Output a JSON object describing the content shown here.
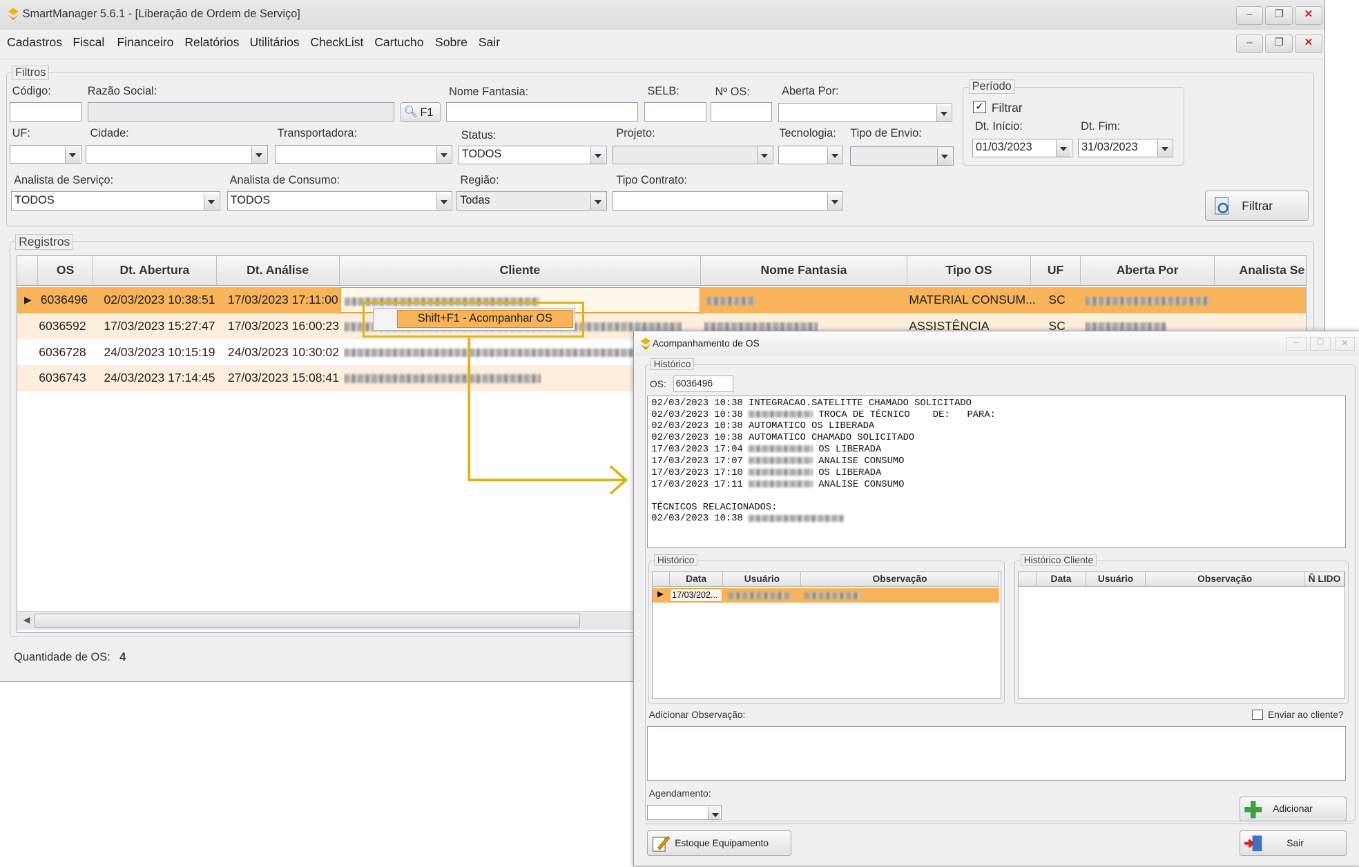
{
  "main": {
    "title": "SmartManager 5.6.1 - [Liberação de Ordem de Serviço]",
    "menu": [
      "Cadastros",
      "Fiscal",
      "Financeiro",
      "Relatórios",
      "Utilitários",
      "CheckList",
      "Cartucho",
      "Sobre",
      "Sair"
    ],
    "filters": {
      "group_label": "Filtros",
      "codigo": "Código:",
      "razao_social": "Razão Social:",
      "f1_button": "F1",
      "nome_fantasia": "Nome Fantasia:",
      "selb": "SELB:",
      "nos": "Nº OS:",
      "aberta_por": "Aberta Por:",
      "uf": "UF:",
      "cidade": "Cidade:",
      "transportadora": "Transportadora:",
      "status": "Status:",
      "status_value": "TODOS",
      "projeto": "Projeto:",
      "tecnologia": "Tecnologia:",
      "tipo_envio": "Tipo de Envio:",
      "analista_servico": "Analista de Serviço:",
      "analista_servico_value": "TODOS",
      "analista_consumo": "Analista de Consumo:",
      "analista_consumo_value": "TODOS",
      "regiao": "Região:",
      "regiao_value": "Todas",
      "tipo_contrato": "Tipo Contrato:",
      "periodo": {
        "label": "Período",
        "filtrar_checkbox": "Filtrar",
        "filtrar_checked": true,
        "dt_inicio_label": "Dt. Início:",
        "dt_inicio": "01/03/2023",
        "dt_fim_label": "Dt. Fim:",
        "dt_fim": "31/03/2023"
      },
      "filtrar_button": "Filtrar"
    },
    "registros": {
      "group_label": "Registros",
      "columns": [
        "OS",
        "Dt. Abertura",
        "Dt. Análise",
        "Cliente",
        "Nome Fantasia",
        "Tipo OS",
        "UF",
        "Aberta Por",
        "Analista Se"
      ],
      "rows": [
        {
          "os": "6036496",
          "abertura": "02/03/2023 10:38:51",
          "analise": "17/03/2023 17:11:00",
          "tipo": "MATERIAL CONSUM...",
          "uf": "SC"
        },
        {
          "os": "6036592",
          "abertura": "17/03/2023 15:27:47",
          "analise": "17/03/2023 16:00:23",
          "tipo": "ASSISTÊNCIA",
          "uf": "SC"
        },
        {
          "os": "6036728",
          "abertura": "24/03/2023 10:15:19",
          "analise": "24/03/2023 10:30:02",
          "tipo": "",
          "uf": ""
        },
        {
          "os": "6036743",
          "abertura": "24/03/2023 17:14:45",
          "analise": "27/03/2023 15:08:41",
          "tipo": "",
          "uf": ""
        }
      ],
      "selected_row": 0
    },
    "context_menu": "Shift+F1 - Acompanhar OS",
    "quantidade_label": "Quantidade de OS:",
    "quantidade_value": "4"
  },
  "dialog": {
    "title": "Acompanhamento de OS",
    "historico_group": "Histórico",
    "os_label": "OS:",
    "os_value": "6036496",
    "log": [
      {
        "ts": "02/03/2023 10:38",
        "user": false,
        "text": "INTEGRACAO.SATELITTE CHAMADO SOLICITADO"
      },
      {
        "ts": "02/03/2023 10:38",
        "user": true,
        "text": "TROCA DE TÉCNICO    DE:   PARA:"
      },
      {
        "ts": "02/03/2023 10:38",
        "user": false,
        "text": "AUTOMATICO OS LIBERADA"
      },
      {
        "ts": "02/03/2023 10:38",
        "user": false,
        "text": "AUTOMATICO CHAMADO SOLICITADO"
      },
      {
        "ts": "17/03/2023 17:04",
        "user": true,
        "text": "OS LIBERADA"
      },
      {
        "ts": "17/03/2023 17:07",
        "user": true,
        "text": "ANALISE CONSUMO"
      },
      {
        "ts": "17/03/2023 17:10",
        "user": true,
        "text": "OS LIBERADA"
      },
      {
        "ts": "17/03/2023 17:11",
        "user": true,
        "text": "ANALISE CONSUMO"
      }
    ],
    "tecnicos_label": "TÉCNICOS RELACIONADOS:",
    "tecnicos_ts": "02/03/2023 10:38",
    "hist_sub_label": "Histórico",
    "hist_columns": [
      "Data",
      "Usuário",
      "Observação"
    ],
    "hist_row_date": "17/03/202...",
    "hist_cliente_label": "Histórico Cliente",
    "hist_cliente_columns": [
      "Data",
      "Usuário",
      "Observação",
      "Ñ LIDO"
    ],
    "add_obs_label": "Adicionar Observação:",
    "enviar_cliente": "Enviar ao cliente?",
    "agendamento_label": "Agendamento:",
    "adicionar_button": "Adicionar",
    "estoque_button": "Estoque Equipamento",
    "sair_button": "Sair"
  },
  "colors": {
    "highlight": "#f9b35b",
    "row_alt": "#fdefdc",
    "annotation": "#e0b21a"
  }
}
